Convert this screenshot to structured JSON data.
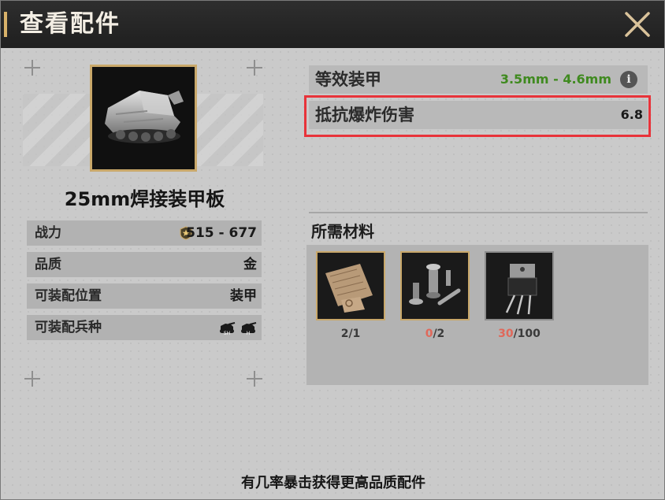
{
  "window": {
    "title": "查看配件"
  },
  "item": {
    "name": "25mm焊接装甲板",
    "stats": [
      {
        "label": "战力",
        "value": "515 - 677"
      },
      {
        "label": "品质",
        "value": "金"
      },
      {
        "label": "可装配位置",
        "value": "装甲"
      },
      {
        "label": "可装配兵种",
        "value": "",
        "value_icons": [
          "SH",
          "H"
        ]
      }
    ]
  },
  "attributes": [
    {
      "label": "等效装甲",
      "value": "3.5mm - 4.6mm",
      "value_color": "#3f8a1f"
    },
    {
      "label": "抵抗爆炸伤害",
      "value": "6.8",
      "value_color": "#1a1a1a"
    }
  ],
  "materials": {
    "title": "所需材料",
    "items": [
      {
        "icon": "blueprint-icon",
        "have": "2",
        "need": "/1",
        "sufficient": true
      },
      {
        "icon": "mechanical-parts-icon",
        "have": "0",
        "need": "/2",
        "sufficient": false
      },
      {
        "icon": "transistor-icon",
        "have": "30",
        "need": "/100",
        "sufficient": false
      }
    ]
  },
  "footer": {
    "text": "有几率暴击获得更高品质配件"
  },
  "colors": {
    "accent": "#d9b26a",
    "highlight": "#e8333a",
    "insufficient": "#e0685a",
    "positive": "#3f8a1f"
  }
}
